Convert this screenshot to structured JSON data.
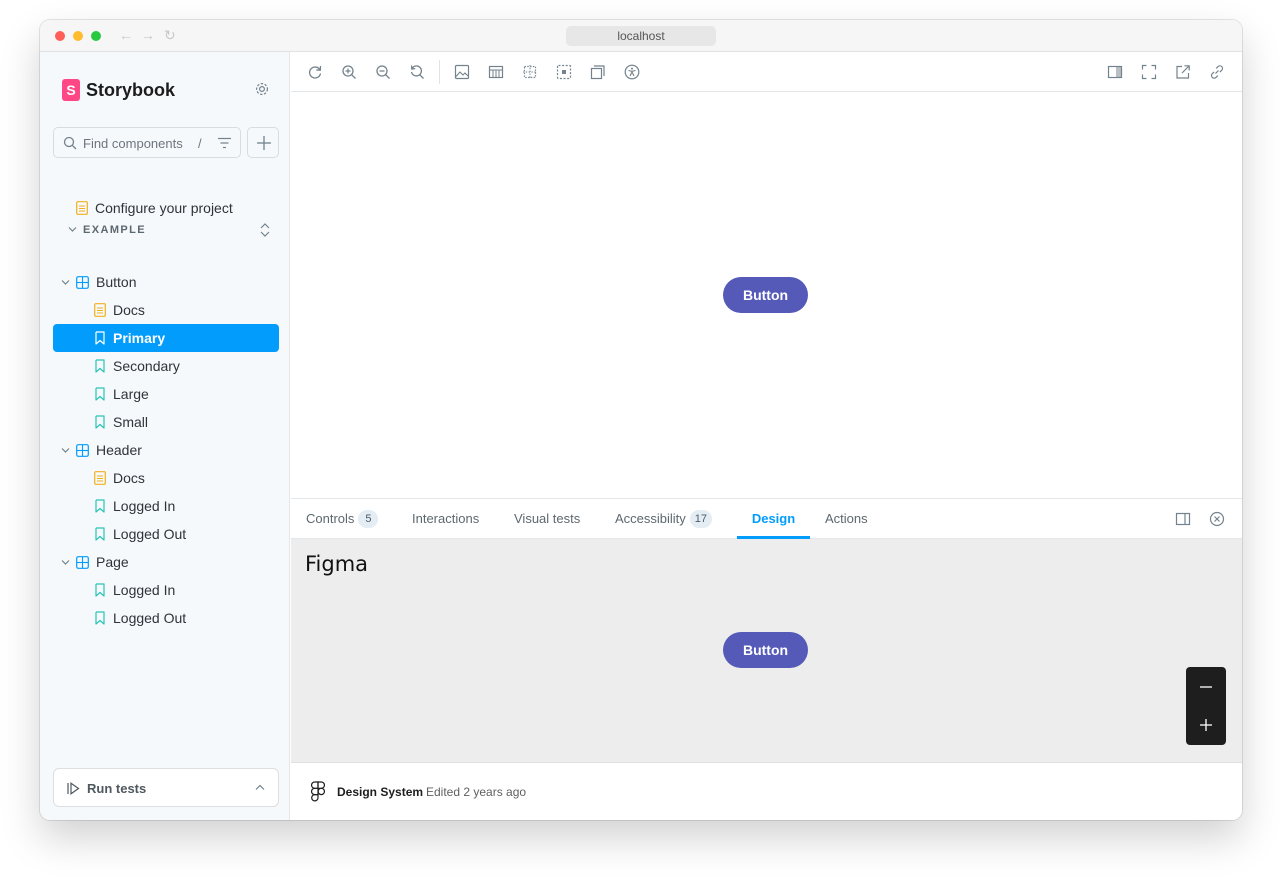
{
  "window": {
    "url": "localhost",
    "colors": {
      "close": "#fe5f57",
      "minimize": "#febc2e",
      "maximize": "#28c840"
    }
  },
  "sidebar": {
    "brand": "Storybook",
    "brand_mark": "S",
    "search": {
      "placeholder": "Find components",
      "shortcut": "/"
    },
    "configure_item": "Configure your project",
    "section": "EXAMPLE",
    "tree": [
      {
        "label": "Button",
        "kind": "component"
      },
      {
        "label": "Docs",
        "kind": "docs"
      },
      {
        "label": "Primary",
        "kind": "story",
        "selected": true
      },
      {
        "label": "Secondary",
        "kind": "story"
      },
      {
        "label": "Large",
        "kind": "story"
      },
      {
        "label": "Small",
        "kind": "story"
      },
      {
        "label": "Header",
        "kind": "component"
      },
      {
        "label": "Docs",
        "kind": "docs"
      },
      {
        "label": "Logged In",
        "kind": "story"
      },
      {
        "label": "Logged Out",
        "kind": "story"
      },
      {
        "label": "Page",
        "kind": "component"
      },
      {
        "label": "Logged In",
        "kind": "story"
      },
      {
        "label": "Logged Out",
        "kind": "story"
      }
    ],
    "run_tests": "Run tests"
  },
  "toolbar": {
    "left_icons": [
      "reload-icon",
      "zoom-in-icon",
      "zoom-out-icon",
      "zoom-reset-icon",
      "background-icon",
      "grid-icon",
      "measure-icon",
      "outline-icon",
      "viewport-icon",
      "accessibility-icon"
    ],
    "right_icons": [
      "panel-toggle-icon",
      "fullscreen-icon",
      "open-new-tab-icon",
      "copy-link-icon"
    ]
  },
  "preview": {
    "button_label": "Button"
  },
  "addons": {
    "tabs": [
      {
        "label": "Controls",
        "badge": "5"
      },
      {
        "label": "Interactions"
      },
      {
        "label": "Visual tests"
      },
      {
        "label": "Accessibility",
        "badge": "17"
      },
      {
        "label": "Design",
        "active": true
      },
      {
        "label": "Actions"
      }
    ],
    "figma_title": "Figma",
    "figma_button_label": "Button",
    "footer": {
      "file_name": "Design System",
      "edited": "Edited 2 years ago"
    }
  },
  "colors": {
    "accent": "#029cfd",
    "brand": "#ff4785",
    "button": "#555ab9"
  }
}
